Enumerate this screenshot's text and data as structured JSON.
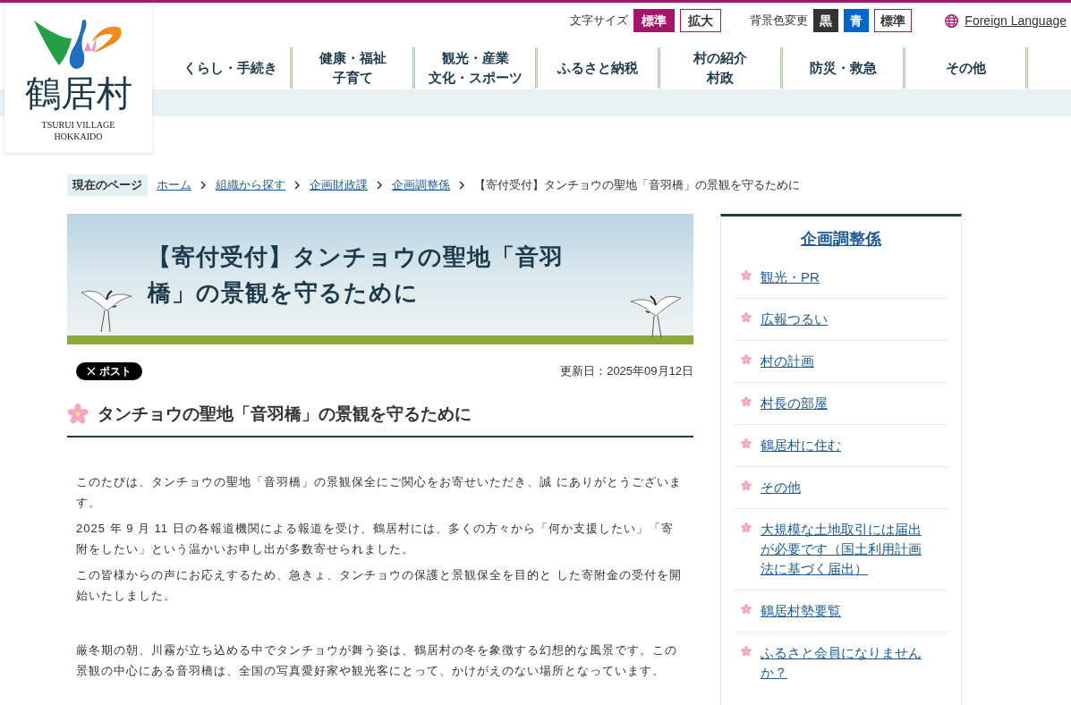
{
  "logo": {
    "name": "鶴居村",
    "subtitle_lines": [
      "TSURUI VILLAGE",
      "HOKKAIDO"
    ]
  },
  "utility": {
    "font_size": {
      "label": "文字サイズ",
      "options": [
        {
          "label": "標準",
          "selected": true
        },
        {
          "label": "拡大",
          "selected": false
        }
      ]
    },
    "background": {
      "label": "背景色変更",
      "options": [
        {
          "label": "黒",
          "kind": "black"
        },
        {
          "label": "青",
          "kind": "blue"
        },
        {
          "label": "標準",
          "kind": "standard"
        }
      ]
    },
    "foreign_language": "Foreign Language"
  },
  "nav": [
    {
      "lines": [
        "くらし・手続き"
      ]
    },
    {
      "lines": [
        "健康・福祉",
        "子育て"
      ]
    },
    {
      "lines": [
        "観光・産業",
        "文化・スポーツ"
      ]
    },
    {
      "lines": [
        "ふるさと納税"
      ]
    },
    {
      "lines": [
        "村の紹介",
        "村政"
      ]
    },
    {
      "lines": [
        "防災・救急"
      ]
    },
    {
      "lines": [
        "その他"
      ]
    }
  ],
  "breadcrumb": {
    "label": "現在のページ",
    "links": [
      "ホーム",
      "組織から探す",
      "企画財政課",
      "企画調整係"
    ],
    "current": "【寄付受付】タンチョウの聖地「音羽橋」の景観を守るために"
  },
  "article": {
    "title": "【寄付受付】タンチョウの聖地「音羽橋」の景観を守るために",
    "post_button": "ポスト",
    "updated": "更新日：2025年09月12日",
    "heading": "タンチョウの聖地「音羽橋」の景観を守るために",
    "paragraph_groups": [
      [
        "このたびは、タンチョウの聖地「音羽橋」の景観保全にご関心をお寄せいただき、誠 にありがとうございます。",
        "2025 年 9 月 11 日の各報道機関による報道を受け、鶴居村には、多くの方々から「何か支援したい」「寄附をしたい」という温かいお申し出が多数寄せられました。",
        "この皆様からの声にお応えするため、急きょ、タンチョウの保護と景観保全を目的と した寄附金の受付を開始いたしました。"
      ],
      [
        "厳冬期の朝、川霧が立ち込める中でタンチョウが舞う姿は、鶴居村の冬を象徴する幻想的な風景です。この景観の中心にある音羽橋は、全国の写真愛好家や観光客にとって、かけがえのない場所となっています。"
      ]
    ]
  },
  "sidebar": {
    "title": "企画調整係",
    "items": [
      "観光・PR",
      "広報つるい",
      "村の計画",
      "村長の部屋",
      "鶴居村に住む",
      "その他",
      "大規模な土地取引には届出が必要です（国土利用計画法に基づく届出）",
      "鶴居村勢要覧",
      "ふるさと会員になりませんか？"
    ]
  }
}
